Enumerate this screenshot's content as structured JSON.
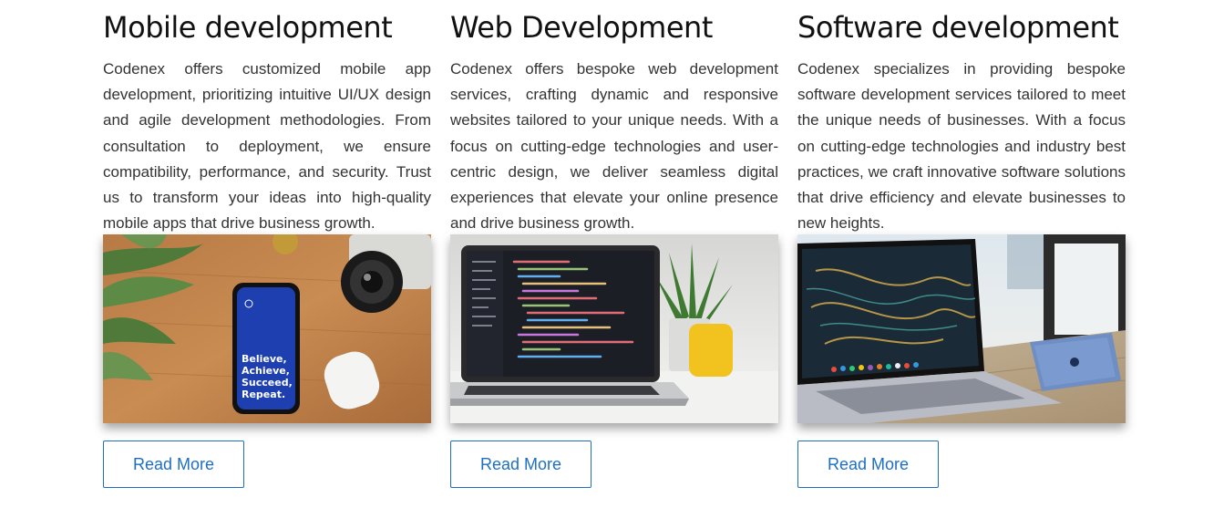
{
  "services": [
    {
      "title": "Mobile development",
      "description": "Codenex offers customized mobile app development, prioritizing intuitive UI/UX design and agile development methodologies. From consultation to deployment, we ensure compatibility, performance, and security. Trust us to transform your ideas into high-quality mobile apps that drive business growth.",
      "image": {
        "icon": "phone-on-desk-photo",
        "phone_screen_text": [
          "Believe,",
          "Achieve,",
          "Succeed,",
          "Repeat."
        ]
      },
      "button_label": "Read More"
    },
    {
      "title": "Web Development",
      "description": "Codenex offers bespoke web development services, crafting dynamic and responsive websites tailored to your unique needs. With a focus on cutting-edge technologies and user-centric design, we deliver seamless digital experiences that elevate your online presence and drive business growth.",
      "image": {
        "icon": "laptop-code-photo"
      },
      "button_label": "Read More"
    },
    {
      "title": "Software development",
      "description": "Codenex specializes in providing bespoke software development services tailored to meet the unique needs of businesses. With a focus on cutting-edge technologies and industry best practices, we craft innovative software solutions that drive efficiency and elevate businesses to new heights.",
      "image": {
        "icon": "laptop-tablet-photo"
      },
      "button_label": "Read More"
    }
  ],
  "colors": {
    "accent": "#1e6fc2",
    "title": "#111111",
    "body_text": "#333333"
  }
}
